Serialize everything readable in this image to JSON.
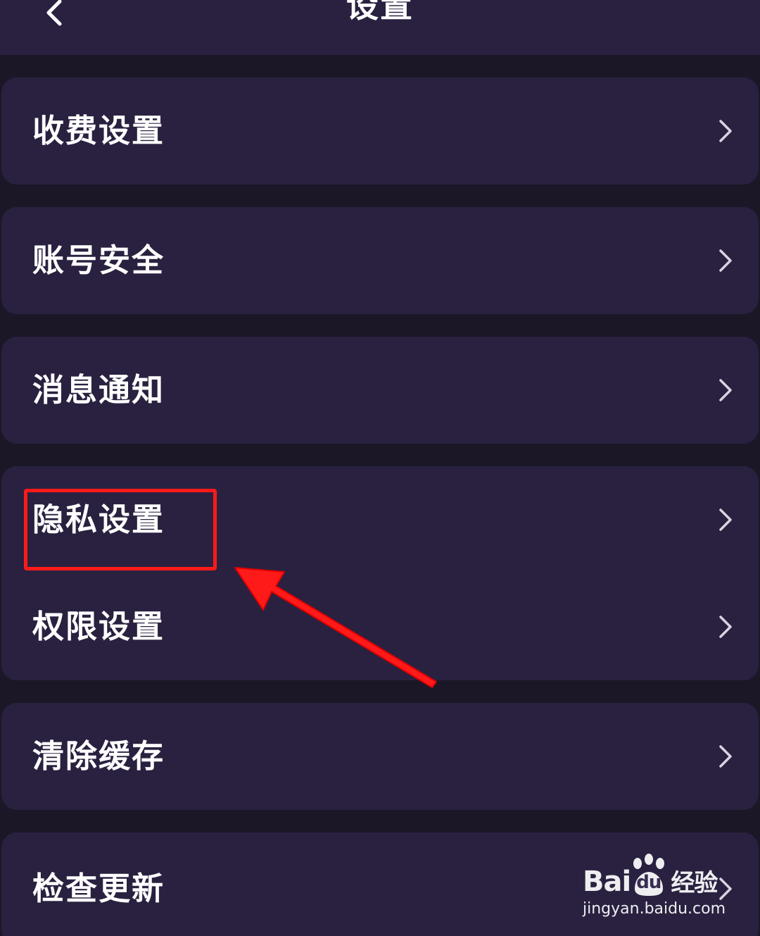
{
  "header": {
    "title": "设置",
    "back_icon": "chevron-left-icon"
  },
  "settings": {
    "items": [
      {
        "label": "收费设置",
        "icon": "chevron-right-icon"
      },
      {
        "label": "账号安全",
        "icon": "chevron-right-icon"
      },
      {
        "label": "消息通知",
        "icon": "chevron-right-icon"
      },
      {
        "label": "隐私设置",
        "icon": "chevron-right-icon"
      },
      {
        "label": "权限设置",
        "icon": "chevron-right-icon"
      },
      {
        "label": "清除缓存",
        "icon": "chevron-right-icon"
      },
      {
        "label": "检查更新",
        "icon": "chevron-right-icon"
      }
    ]
  },
  "annotation": {
    "highlighted_item": "隐私设置",
    "color": "#ff1a1a"
  },
  "watermark": {
    "logo_prefix": "Bai",
    "logo_du": "du",
    "logo_suffix": "经验",
    "url": "jingyan.baidu.com"
  },
  "colors": {
    "background": "#1b1727",
    "card": "#2a2140",
    "text": "#ffffff",
    "chevron": "#d8d4e0"
  }
}
